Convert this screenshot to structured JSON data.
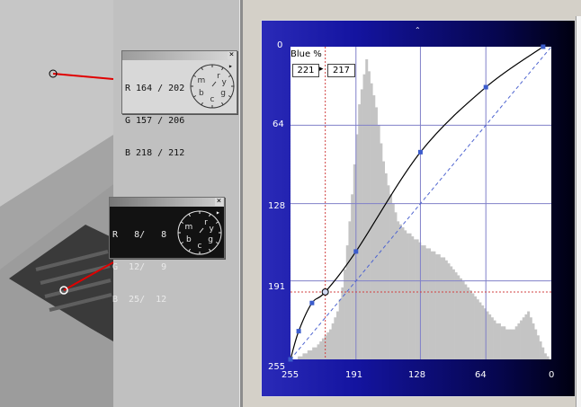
{
  "probe_top": {
    "rows": [
      "R 164 / 202",
      "G 157 / 206",
      "B 218 / 212"
    ],
    "dial_letters": [
      "r",
      "y",
      "g",
      "c",
      "b",
      "m"
    ],
    "close_glyph": "×",
    "menu_glyph": "▸"
  },
  "probe_bottom": {
    "rows": [
      "R   8/   8",
      "G  12/   9",
      "B  25/  12"
    ],
    "dial_letters": [
      "r",
      "y",
      "g",
      "c",
      "b",
      "m"
    ],
    "close_glyph": "×",
    "menu_glyph": "▸"
  },
  "curves_dialog": {
    "channel_label": "Blue %",
    "input_value": "221",
    "output_value": "217",
    "arrow_glyph": "▸",
    "resize_glyph": "⌃",
    "y_axis_labels": [
      "0",
      "64",
      "128",
      "191",
      "255"
    ],
    "x_axis_labels": [
      "255",
      "191",
      "128",
      "64",
      "0"
    ],
    "colors": {
      "histogram": "#c4c4c4",
      "grid": "#8080c8",
      "curve": "#000000",
      "control_point": "#3b5ccc",
      "identity_line": "#4e64d0",
      "crosshair": "#d04040",
      "background_top": "#2a2ab8"
    }
  },
  "chart_data": {
    "type": "line",
    "xlim": [
      255,
      0
    ],
    "ylim": [
      0,
      255
    ],
    "series": [
      {
        "values": [
          [
            255,
            255
          ],
          [
            247,
            232
          ],
          [
            234,
            209
          ],
          [
            221,
            200
          ],
          [
            191,
            167
          ],
          [
            128,
            86
          ],
          [
            64,
            33
          ],
          [
            8,
            0
          ]
        ]
      }
    ],
    "control_points": [
      [
        255,
        255
      ],
      [
        247,
        232
      ],
      [
        234,
        209
      ],
      [
        221,
        200
      ],
      [
        191,
        167
      ],
      [
        128,
        86
      ],
      [
        64,
        33
      ],
      [
        8,
        0
      ]
    ],
    "selected_point": [
      221,
      200
    ],
    "histogram": [
      0,
      0,
      0,
      1,
      1,
      2,
      2,
      3,
      3,
      4,
      4,
      5,
      6,
      7,
      8,
      9,
      10,
      12,
      14,
      16,
      20,
      24,
      30,
      38,
      46,
      55,
      65,
      75,
      85,
      90,
      95,
      100,
      96,
      92,
      88,
      84,
      78,
      72,
      66,
      62,
      58,
      55,
      52,
      49,
      46,
      45,
      44,
      43,
      42,
      42,
      41,
      40,
      40,
      39,
      38,
      38,
      37,
      37,
      36,
      36,
      35,
      35,
      34,
      34,
      33,
      32,
      31,
      30,
      29,
      28,
      27,
      26,
      25,
      24,
      23,
      22,
      21,
      20,
      19,
      18,
      17,
      16,
      15,
      14,
      13,
      12,
      12,
      11,
      11,
      10,
      10,
      10,
      10,
      11,
      12,
      13,
      14,
      15,
      16,
      14,
      12,
      10,
      8,
      6,
      4,
      2,
      1,
      0
    ],
    "grid": true
  }
}
